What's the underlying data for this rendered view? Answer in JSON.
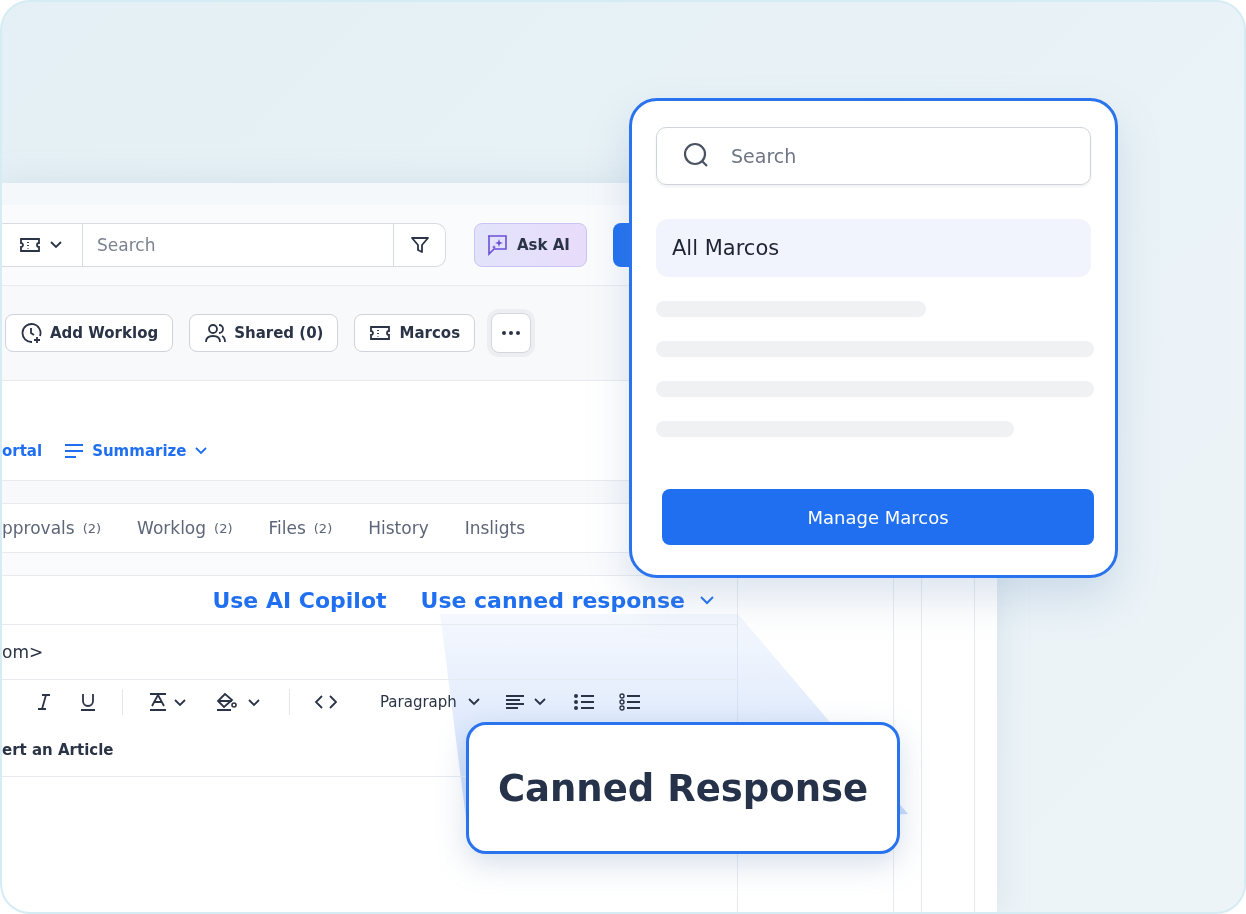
{
  "toolbar": {
    "search": {
      "placeholder": "Search"
    },
    "ask_ai": "Ask AI"
  },
  "actions": [
    {
      "label": "Add Worklog",
      "kind": "worklog"
    },
    {
      "label": "Shared (0)",
      "kind": "shared"
    },
    {
      "label": "Marcos",
      "kind": "macros"
    },
    {
      "kind": "more"
    }
  ],
  "links": [
    {
      "label": "ortal",
      "kind": "plain"
    },
    {
      "label": "Summarize",
      "kind": "summarize"
    }
  ],
  "tabs": [
    {
      "label": "pprovals",
      "count": "(2)"
    },
    {
      "label": "Worklog",
      "count": "(2)"
    },
    {
      "label": "Files",
      "count": "(2)"
    },
    {
      "label": "History"
    },
    {
      "label": "Insligts"
    }
  ],
  "reply": {
    "options": [
      "Use AI Copilot",
      "Use canned response"
    ],
    "recipient": "om>",
    "block_style": "Paragraph",
    "insert_article": "ert an Article"
  },
  "macros_popup": {
    "search": {
      "placeholder": "Search"
    },
    "items": [
      {
        "label": "All Marcos",
        "selected": true
      }
    ],
    "button": "Manage Marcos"
  },
  "callout": "Canned Response"
}
